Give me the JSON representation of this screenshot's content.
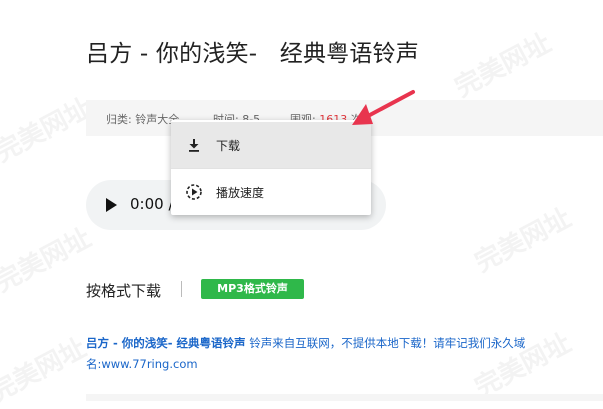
{
  "title": "吕方 - 你的浅笑-   经典粤语铃声",
  "meta": {
    "category_label": "归类:",
    "category_value": "铃声大全",
    "time_label": "时间:",
    "time_value": "8-5",
    "views_label": "围观:",
    "views_value": "1613",
    "views_suffix": "次"
  },
  "audio": {
    "time": "0:00 /"
  },
  "context_menu": {
    "items": [
      {
        "label": "下载",
        "icon": "download-icon"
      },
      {
        "label": "播放速度",
        "icon": "playback-speed-icon"
      }
    ]
  },
  "download_section": {
    "label": "按格式下载",
    "mp3_button": "MP3格式铃声"
  },
  "description": {
    "song_name": "吕方 - 你的浅笑-   经典粤语铃声",
    "text": " 铃声来自互联网，不提供本地下载！请牢记我们永久域名:www.77ring.com"
  },
  "watermark": "完美网址",
  "colors": {
    "accent_green": "#2fb84a",
    "hot_red": "#e0383e",
    "link_blue": "#1a66c9",
    "arrow": "#e8344e"
  }
}
